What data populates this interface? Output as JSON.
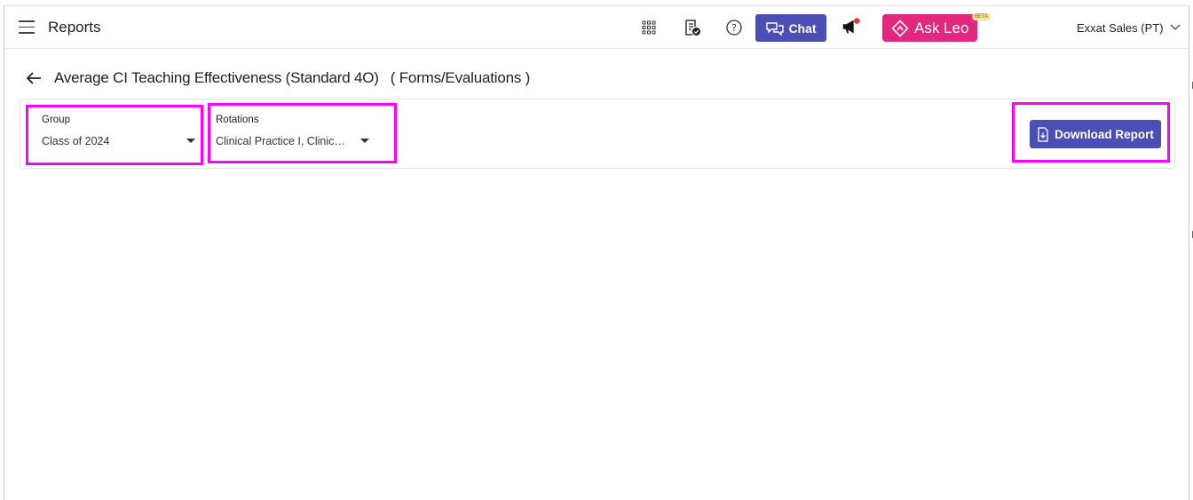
{
  "topbar": {
    "title": "Reports",
    "icons": [
      "grid-icon",
      "report-check-icon",
      "help-icon",
      "megaphone-icon"
    ],
    "chat_label": "Chat",
    "ask_leo_label": "Ask Leo",
    "beta_label": "BETA",
    "user_name": "Exxat Sales (PT)"
  },
  "page": {
    "title": "Average CI Teaching Effectiveness (Standard 4O)",
    "subtitle": "( Forms/Evaluations )"
  },
  "filters": {
    "group_label": "Group",
    "group_value": "Class of 2024",
    "rotations_label": "Rotations",
    "rotations_value": "Clinical Practice I, Clinic…"
  },
  "actions": {
    "download_label": "Download Report"
  },
  "colors": {
    "primary": "#4b4fb5",
    "ask_leo": "#e2277e",
    "highlight": "#ff00ff",
    "notification_dot": "#e53935"
  }
}
